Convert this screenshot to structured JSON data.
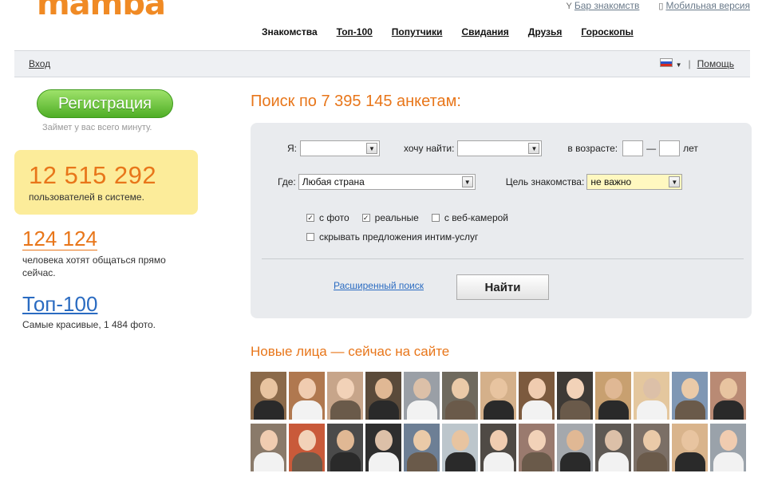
{
  "brand": {
    "logo": "mamba"
  },
  "top_links": [
    {
      "icon": "glass-icon",
      "label": "Бар знакомств"
    },
    {
      "icon": "phone-icon",
      "label": "Мобильная версия"
    }
  ],
  "main_nav": [
    "Знакомства",
    "Топ-100",
    "Попутчики",
    "Свидания",
    "Друзья",
    "Гороскопы"
  ],
  "bar": {
    "login": "Вход",
    "help": "Помощь"
  },
  "register": {
    "button": "Регистрация",
    "note": "Займет у вас всего минуту."
  },
  "stats": {
    "users_count": "12 515 292",
    "users_label": "пользователей в системе.",
    "online_count": "124 124",
    "online_label": "человека хотят общаться прямо сейчас.",
    "top_title": "Топ-100",
    "top_label": "Самые красивые, 1 484 фото."
  },
  "search": {
    "title": "Поиск по 7 395 145 анкетам:",
    "i_label": "Я:",
    "i_value": "",
    "find_label": "хочу найти:",
    "find_value": "",
    "age_label": "в возрасте:",
    "age_dash": "—",
    "age_unit": "лет",
    "where_label": "Где:",
    "where_value": "Любая страна",
    "goal_label": "Цель знакомства:",
    "goal_value": "не важно",
    "cb_photo": "с фото",
    "cb_real": "реальные",
    "cb_webcam": "с веб-камерой",
    "cb_hide": "скрывать предложения интим-услуг",
    "advanced": "Расширенный поиск",
    "find_button": "Найти"
  },
  "faces": {
    "title": "Новые лица — сейчас на сайте",
    "count": 26
  }
}
